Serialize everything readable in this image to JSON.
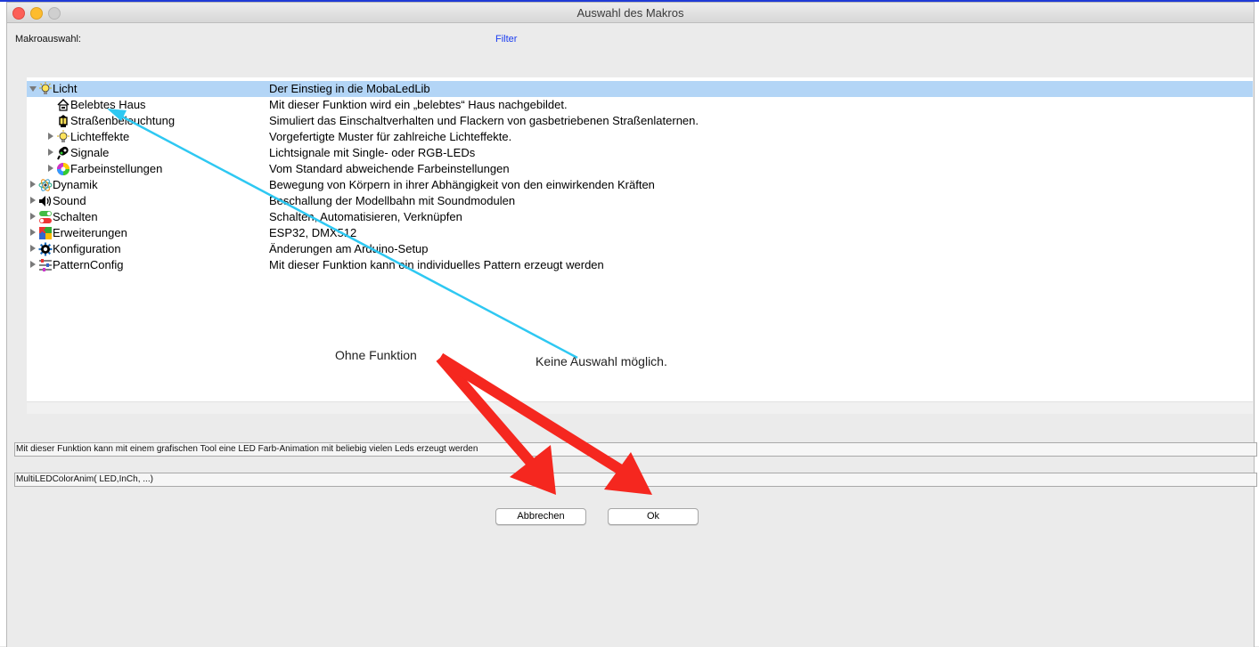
{
  "window": {
    "title": "Auswahl des Makros"
  },
  "header": {
    "macro_label": "Makroauswahl:",
    "filter_label": "Filter"
  },
  "tree": {
    "rows": [
      {
        "label": "Licht",
        "desc": "Der Einstieg in die MobaLedLib",
        "icon": "lightbulb-icon",
        "expanded": true,
        "selected": true
      },
      {
        "label": "Belebtes Haus",
        "desc": "Mit dieser Funktion wird ein „belebtes“ Haus nachgebildet.",
        "icon": "house-icon"
      },
      {
        "label": "Straßenbeleuchtung",
        "desc": "Simuliert das Einschaltverhalten und Flackern von gasbetriebenen Straßenlaternen.",
        "icon": "lantern-icon"
      },
      {
        "label": "Lichteffekte",
        "desc": "Vorgefertigte Muster für zahlreiche Lichteffekte.",
        "icon": "lightbulb-icon"
      },
      {
        "label": "Signale",
        "desc": "Lichtsignale mit Single- oder RGB-LEDs",
        "icon": "signal-icon"
      },
      {
        "label": "Farbeinstellungen",
        "desc": "Vom Standard abweichende Farbeinstellungen",
        "icon": "color-wheel-icon"
      },
      {
        "label": "Dynamik",
        "desc": "Bewegung von Körpern in ihrer Abhängigkeit von den einwirkenden Kräften",
        "icon": "atom-icon"
      },
      {
        "label": "Sound",
        "desc": "Beschallung der Modellbahn mit Soundmodulen",
        "icon": "speaker-icon"
      },
      {
        "label": "Schalten",
        "desc": "Schalten, Automatisieren, Verknüpfen",
        "icon": "switch-icon"
      },
      {
        "label": "Erweiterungen",
        "desc": "ESP32, DMX512",
        "icon": "puzzle-icon"
      },
      {
        "label": "Konfiguration",
        "desc": "Änderungen am Arduino-Setup",
        "icon": "gear-icon"
      },
      {
        "label": "PatternConfig",
        "desc": "Mit dieser Funktion kann ein individuelles Pattern erzeugt werden",
        "icon": "sliders-icon"
      }
    ]
  },
  "info": {
    "description": "Mit dieser Funktion kann mit einem grafischen Tool eine LED Farb-Animation mit beliebig vielen Leds erzeugt werden",
    "macro_signature": "MultiLEDColorAnim( LED,InCh, ...)"
  },
  "buttons": {
    "cancel_label": "Abbrechen",
    "ok_label": "Ok"
  },
  "annotations": {
    "no_function": "Ohne Funktion",
    "no_selection": "Keine Auswahl möglich."
  },
  "colors": {
    "selection": "#b3d5f6",
    "annotation_cyan": "#2ec8f2",
    "annotation_red": "#f5271f",
    "link_blue": "#1a3cf0"
  }
}
